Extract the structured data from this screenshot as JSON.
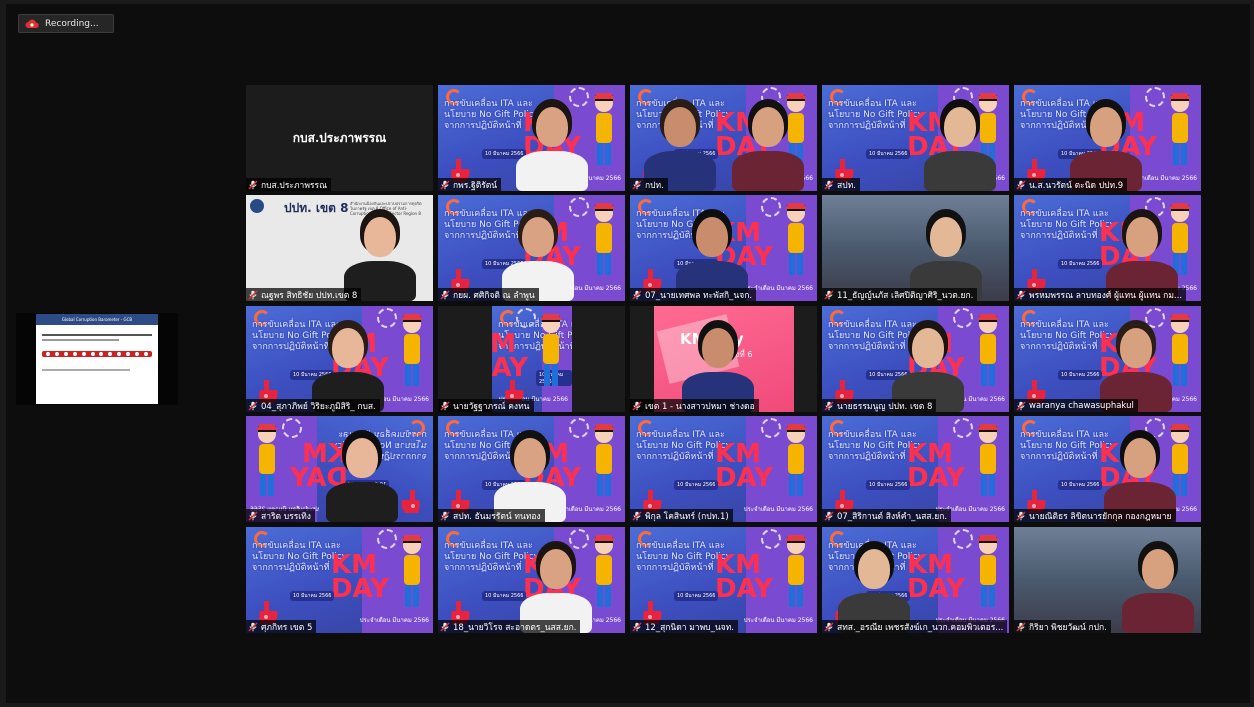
{
  "recording": {
    "label": "Recording..."
  },
  "shared_screen": {
    "slide_title": "Global Corruption Barometer - GCB"
  },
  "slide_background": {
    "heading": "การขับเคลื่อน ITA และนโยบาย No Gift Policy จากการปฏิบัติหน้าที่",
    "km_line1": "KM",
    "km_line2": "DAY",
    "date_small": "10 มีนาคม 2566",
    "date_strip": "ประจำเดือน มีนาคม 2566"
  },
  "name_card": {
    "text": "กบส.ประภาพรรณ"
  },
  "ppt_tile": {
    "title": "ปปท. เขต 8",
    "subtitle": "สำนักงานป้องกันและปราบปรามการทุจริตในภาครัฐ เขต 8 Office of Anti-Corruption in State Sector Region 8"
  },
  "pink_tile": {
    "title": "KM Day",
    "subtitle": "ครั้งที่ 6"
  },
  "participants": [
    {
      "name": "กบส.ประภาพรรณ"
    },
    {
      "name": "กพร.ฐิติรัตน์"
    },
    {
      "name": "กปท."
    },
    {
      "name": "สปท."
    },
    {
      "name": "น.ส.นวรัตน์ ตะนิด ปปท.9"
    },
    {
      "name": "ณฐพร สิทธิชัย ปปท.เขต 8"
    },
    {
      "name": "กยผ. ศศิกิจติ ณ ลำพูน"
    },
    {
      "name": "07_นายเทศพล ทะพัสกิ_นจก."
    },
    {
      "name": "11_ธัญญ์นภัส เลิศปิติญาศิริ_นวต.ยก."
    },
    {
      "name": "พรหมพรรณ ลาบทองศ์ ผู้แทน ผู้แทน กม..."
    },
    {
      "name": "04_สุภาภิพย์ วิริยะภูมิสิริ_ กบส."
    },
    {
      "name": "นายวัฐฐาภรณ์ คงทน"
    },
    {
      "name": "เขต 1 - นางสาวปหมา ช่างดอ"
    },
    {
      "name": "นายธรรมนูญ ปปท. เขต 8"
    },
    {
      "name": "waranya chawasuphakul"
    },
    {
      "name": "สาริต บรรเทิง"
    },
    {
      "name": "สปท. ธันมรรัตน์ ทนทอง"
    },
    {
      "name": "พิกุล โคสินทร์ (กปท.1)"
    },
    {
      "name": "07_สิริกานต์ สิงห์คำ_นสส.ยก."
    },
    {
      "name": "นายณิติธร ลิขิตนารยักกุล กองกฎหมาย"
    },
    {
      "name": "ศุภกิทร เขต 5"
    },
    {
      "name": "18_นายวิโรจ สะอาดตร_นสส.ยก."
    },
    {
      "name": "12_สุกนิดา มาพบ_นจท."
    },
    {
      "name": "สทส._อรณีย เพชรสังฆ์เก_นวก.คอมพิวเตอร..."
    },
    {
      "name": "กิริยา พิชยวัฒน์ กปก."
    }
  ],
  "colors": {
    "mic_muted": "#e03131",
    "active_speaker": "#e8e19a",
    "km_red": "#ff2f4f"
  }
}
